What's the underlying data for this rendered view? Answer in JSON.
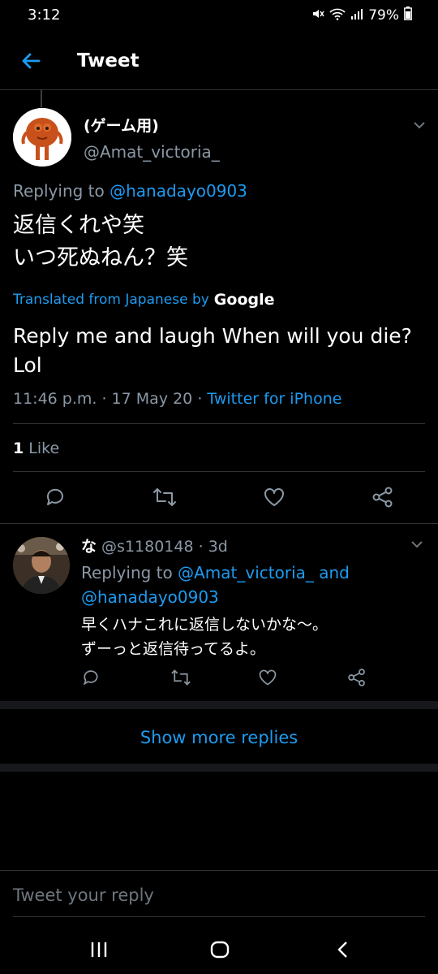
{
  "status_bar": {
    "time": "3:12",
    "battery": "79%"
  },
  "header": {
    "title": "Tweet"
  },
  "tweet": {
    "display_name": "(ゲーム用)",
    "handle": "@Amat_victoria_",
    "replying_prefix": "Replying to",
    "replying_to": "@hanadayo0903",
    "text_line1": "返信くれや笑",
    "text_line2": "いつ死ぬねん？笑",
    "translated_label": "Translated from Japanese by",
    "translated_provider": "Google",
    "translation": "Reply me and laugh When will you die? Lol",
    "timestamp": "11:46 p.m. · 17 May 20 · ",
    "source": "Twitter for iPhone",
    "like_count": "1",
    "like_label": " Like"
  },
  "reply": {
    "display_name": "な",
    "handle_time": " @s1180148 · 3d",
    "replying_prefix": "Replying to ",
    "replying_to_1": "@Amat_victoria_ and",
    "replying_to_2": "@hanadayo0903",
    "text_line1": "早くハナこれに返信しないかな〜。",
    "text_line2": "ずーっと返信待ってるよ。"
  },
  "show_more": "Show more replies",
  "reply_input": {
    "placeholder": "Tweet your reply"
  },
  "colors": {
    "accent": "#1d9bf0",
    "background": "#000000",
    "muted": "#8b98a5"
  }
}
